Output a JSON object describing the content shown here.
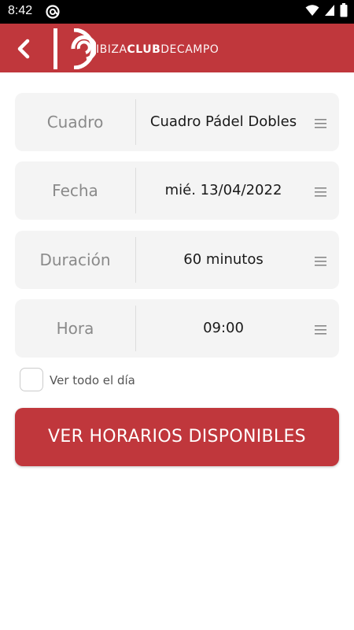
{
  "status_bar": {
    "time": "8:42",
    "icons": [
      "at-sign-icon",
      "wifi-icon",
      "signal-icon",
      "battery-icon"
    ]
  },
  "app_bar": {
    "back_icon": "chevron-left-icon",
    "logo_text_ibiza": "IBIZA",
    "logo_text_club": "CLUB",
    "logo_text_de": "DE",
    "logo_text_campo": "CAMPO",
    "background_color": "#c0373c"
  },
  "form": {
    "fields": [
      {
        "label": "Cuadro",
        "value": "Cuadro Pádel Dobles"
      },
      {
        "label": "Fecha",
        "value": "mié. 13/04/2022"
      },
      {
        "label": "Duración",
        "value": "60 minutos"
      },
      {
        "label": "Hora",
        "value": "09:00"
      }
    ],
    "checkbox_label": "Ver todo el día",
    "checkbox_checked": false
  },
  "primary_button": {
    "label": "VER HORARIOS DISPONIBLES",
    "color": "#c0373c"
  }
}
